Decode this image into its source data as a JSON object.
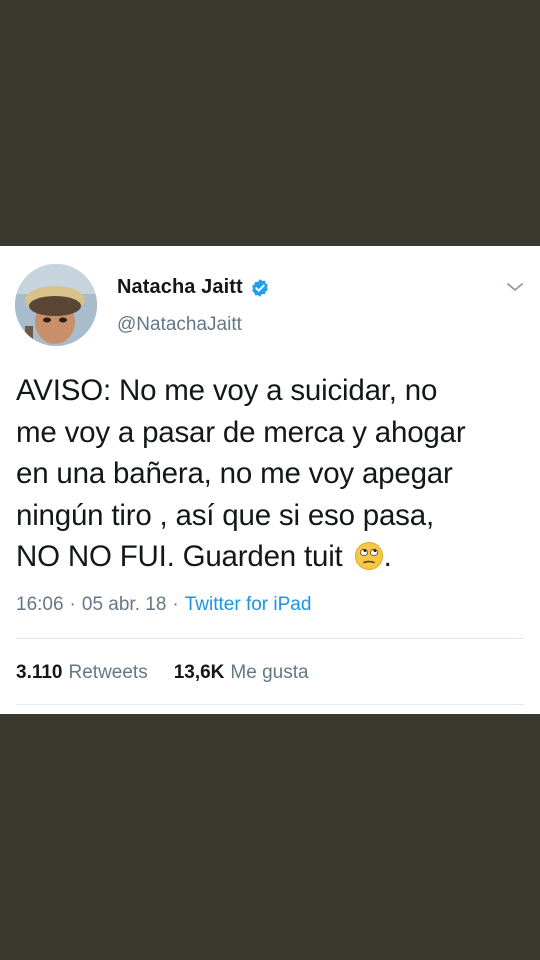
{
  "tweet": {
    "author": {
      "display_name": "Natacha Jaitt",
      "handle": "@NatachaJaitt",
      "verified": true
    },
    "text": "AVISO: No me voy a suicidar, no\nme voy a pasar de merca y ahogar\nen una bañera, no me voy apegar\nningún tiro , así que si eso pasa,\nNO NO FUI. Guarden tuit ",
    "text_end": ".",
    "emoji": "eye-roll-emoji",
    "time": "16:06",
    "separator": "·",
    "date": "05 abr. 18",
    "source": "Twitter for iPad",
    "retweets_count": "3.110",
    "retweets_label": "Retweets",
    "likes_count": "13,6K",
    "likes_label": "Me gusta"
  },
  "colors": {
    "background": "#3a3a2e",
    "card": "#ffffff",
    "text": "#14171a",
    "secondary": "#657786",
    "link": "#1b95e0",
    "verified": "#1da1f2"
  }
}
